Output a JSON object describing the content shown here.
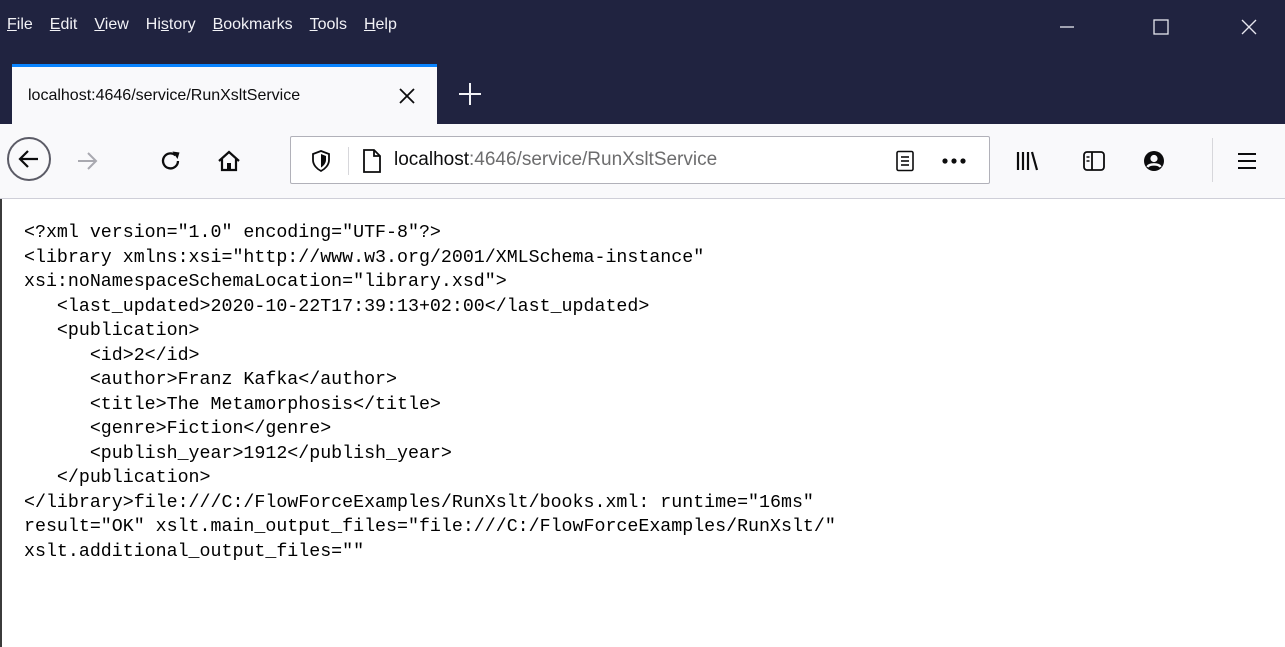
{
  "menu": {
    "items": [
      {
        "label": "File",
        "mnemonic": "F",
        "rest": "ile"
      },
      {
        "label": "Edit",
        "mnemonic": "E",
        "rest": "dit"
      },
      {
        "label": "View",
        "mnemonic": "V",
        "rest": "iew"
      },
      {
        "label": "History",
        "pre": "Hi",
        "mnemonic": "s",
        "rest": "tory"
      },
      {
        "label": "Bookmarks",
        "mnemonic": "B",
        "rest": "ookmarks"
      },
      {
        "label": "Tools",
        "mnemonic": "T",
        "rest": "ools"
      },
      {
        "label": "Help",
        "mnemonic": "H",
        "rest": "elp"
      }
    ]
  },
  "window_controls": {
    "minimize_icon": "minimize-icon",
    "maximize_icon": "maximize-icon",
    "close_icon": "close-icon"
  },
  "tab": {
    "title": "localhost:4646/service/RunXsltService"
  },
  "urlbar": {
    "host": "localhost",
    "path": ":4646/service/RunXsltService"
  },
  "colors": {
    "titlebar": "#202340",
    "tab_accent": "#0a84ff",
    "toolbar": "#f9f9fb"
  },
  "content": {
    "lines": [
      "<?xml version=\"1.0\" encoding=\"UTF-8\"?>",
      "<library xmlns:xsi=\"http://www.w3.org/2001/XMLSchema-instance\"",
      "xsi:noNamespaceSchemaLocation=\"library.xsd\">",
      "   <last_updated>2020-10-22T17:39:13+02:00</last_updated>",
      "   <publication>",
      "      <id>2</id>",
      "      <author>Franz Kafka</author>",
      "      <title>The Metamorphosis</title>",
      "      <genre>Fiction</genre>",
      "      <publish_year>1912</publish_year>",
      "   </publication>",
      "</library>file:///C:/FlowForceExamples/RunXslt/books.xml: runtime=\"16ms\"",
      "result=\"OK\" xslt.main_output_files=\"file:///C:/FlowForceExamples/RunXslt/\"",
      "xslt.additional_output_files=\"\""
    ]
  }
}
